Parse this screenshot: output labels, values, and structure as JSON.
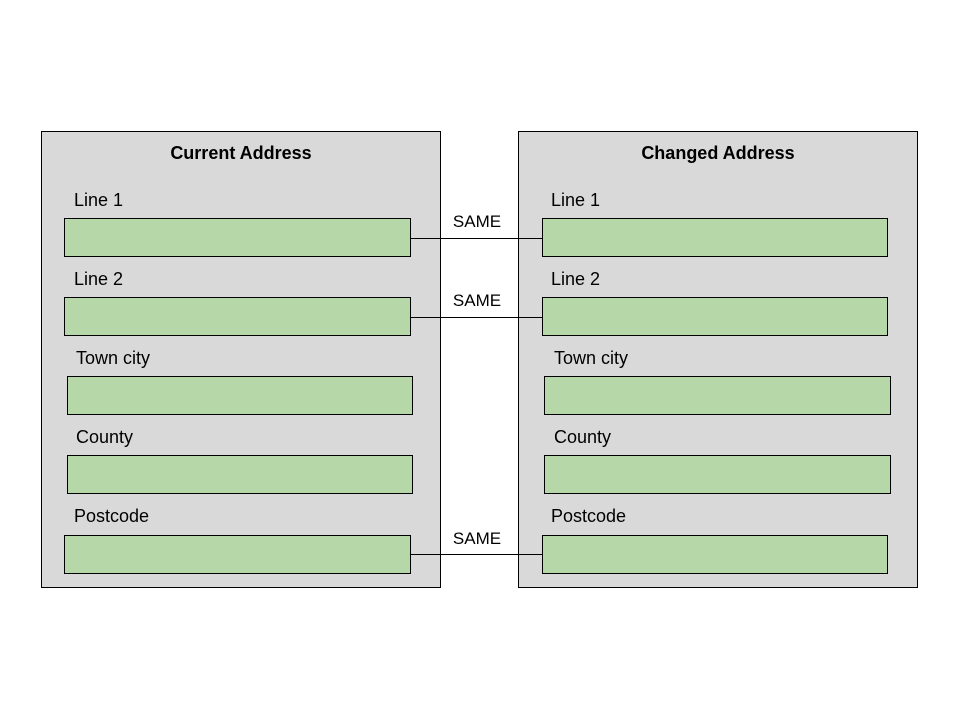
{
  "current": {
    "title": "Current Address",
    "fields": [
      {
        "label": "Line 1",
        "value": ""
      },
      {
        "label": "Line 2",
        "value": ""
      },
      {
        "label": "Town city",
        "value": ""
      },
      {
        "label": "County",
        "value": ""
      },
      {
        "label": "Postcode",
        "value": ""
      }
    ]
  },
  "changed": {
    "title": "Changed Address",
    "fields": [
      {
        "label": "Line 1",
        "value": ""
      },
      {
        "label": "Line 2",
        "value": ""
      },
      {
        "label": "Town city",
        "value": ""
      },
      {
        "label": "County",
        "value": ""
      },
      {
        "label": "Postcode",
        "value": ""
      }
    ]
  },
  "connectors": [
    {
      "label": "SAME",
      "field": "Line 1"
    },
    {
      "label": "SAME",
      "field": "Line 2"
    },
    {
      "label": "SAME",
      "field": "Postcode"
    }
  ],
  "colors": {
    "panel_fill": "#d9d9d9",
    "field_fill": "#b6d7a8",
    "stroke": "#000000"
  }
}
